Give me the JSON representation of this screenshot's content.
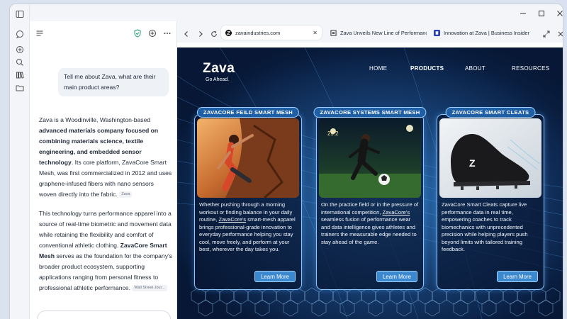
{
  "chat": {
    "user_message": "Tell me about Zava, what are their main product areas?",
    "answer_p1": {
      "t1": "Zava is a Woodinville, Washington-based ",
      "b1": "advanced materials company focused on combining materials science, textile engineering, and embedded sensor technology",
      "t2": ". Its core platform, ZavaCore Smart Mesh, was first commercialized in 2012 and uses graphene-infused fibers with nano sensors woven directly into the fabric.",
      "cite": "Zava"
    },
    "answer_p2": {
      "t1": "This technology turns performance apparel into a source of real-time biometric and movement data while retaining the flexibility and comfort of conventional athletic clothing. ",
      "b1": "ZavaCore Smart Mesh",
      "t2": " serves as the foundation for the company's broader product ecosystem, supporting applications ranging from personal fitness to professional athletic performance.",
      "cite": "Wall Street Jour..."
    }
  },
  "browser": {
    "tabs": [
      {
        "title": "zavaindustries.com",
        "favicon": "zava-favicon",
        "active": true
      },
      {
        "title": "Zava Unveils New Line of Performance",
        "favicon": "news-favicon",
        "active": false
      },
      {
        "title": "Innovation at Zava | Business Insider",
        "favicon": "bi-favicon",
        "active": false
      }
    ]
  },
  "site": {
    "logo": "Zava",
    "tagline": "Go Ahead.",
    "nav": [
      "HOME",
      "PRODUCTS",
      "ABOUT",
      "RESOURCES"
    ],
    "active_nav": "PRODUCTS",
    "cards": [
      {
        "title_pre": "ZAVACORE ",
        "title_bold": "FEILD",
        "title_post": " SMART MESH",
        "desc_a": "Whether pushing through a morning workout or finding balance in your daily routine, ",
        "desc_link": "ZavaCore's",
        "desc_b": " smart-mesh apparel brings professional-grade innovation to everyday performance helping you stay cool, move freely, and perform at your best, wherever the day takes you.",
        "button": "Learn More",
        "image": "climber-photo"
      },
      {
        "title_pre": "ZAVACORE ",
        "title_bold": "SYSTEMS",
        "title_post": " SMART MESH",
        "desc_a": "On the practice field or in the pressure of international competition, ",
        "desc_link": "ZavaCore's",
        "desc_b": " seamless fusion of performance wear and data intelligence gives athletes and trainers the measurable edge needed to stay ahead of the game.",
        "button": "Learn More",
        "image": "soccer-photo",
        "scoreboard": "29.2"
      },
      {
        "title_pre": "ZAVACORE ",
        "title_bold": "SMART CLEATS",
        "title_post": "",
        "desc_a": "ZavaCore Smart Cleats capture live performance data in real time, empowering coaches to track biomechanics with unprecedented precision while helping players push beyond limits with tailored training feedback.",
        "desc_link": "",
        "desc_b": "",
        "button": "Learn More",
        "image": "cleat-photo",
        "cleat_logo": "Z"
      }
    ]
  },
  "colors": {
    "accent": "#1e5fa6",
    "button": "#3b88cf",
    "site_bg": "#0d2a55"
  }
}
